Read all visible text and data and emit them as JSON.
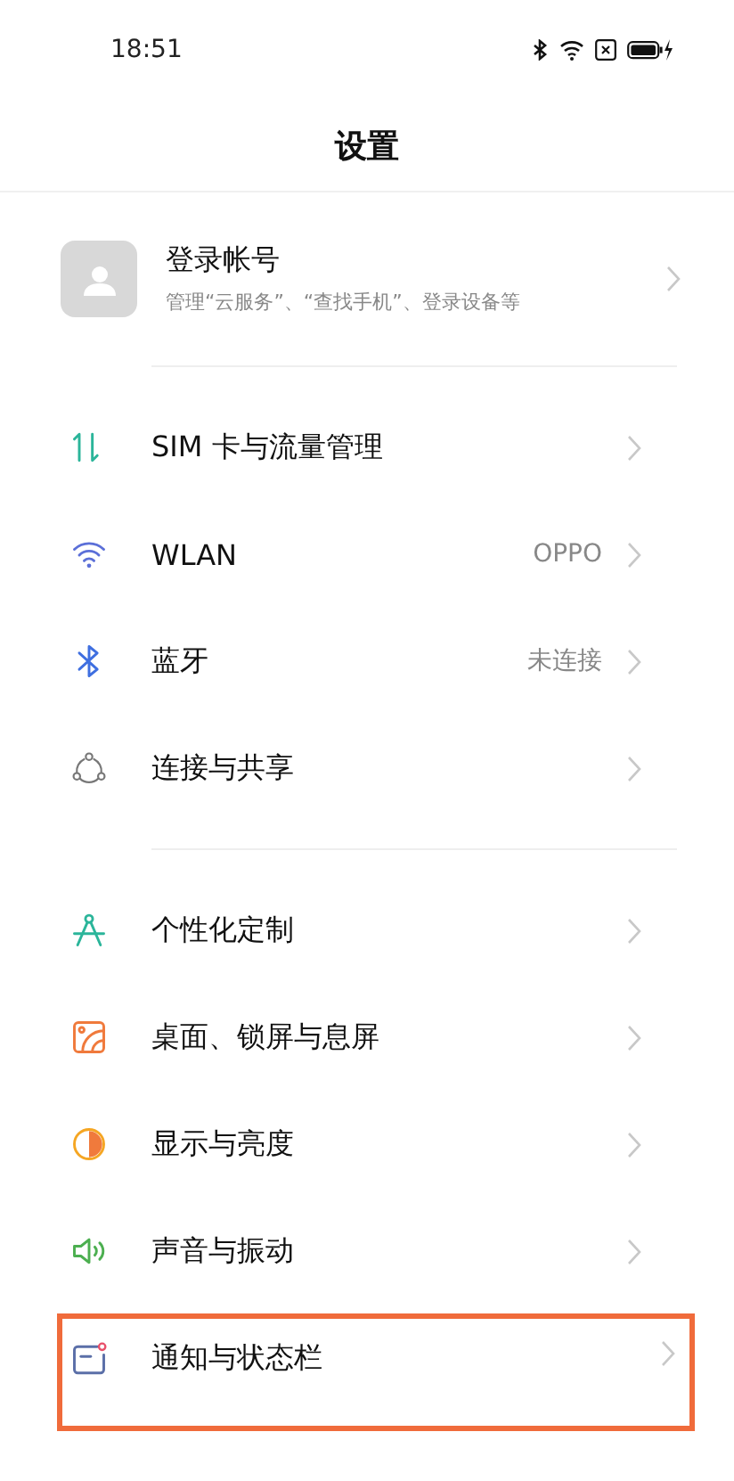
{
  "status_bar": {
    "time": "18:51"
  },
  "title": "设置",
  "account": {
    "name": "登录帐号",
    "subtitle": "管理“云服务”、“查找手机”、登录设备等"
  },
  "groups": [
    [
      {
        "kind": "sim",
        "label": "SIM 卡与流量管理",
        "highlighted": false
      },
      {
        "kind": "wlan",
        "label": "WLAN",
        "value": "OPPO",
        "highlighted": false
      },
      {
        "kind": "bluetooth",
        "label": "蓝牙",
        "value": "未连接",
        "highlighted": false
      },
      {
        "kind": "connect",
        "label": "连接与共享",
        "highlighted": false
      }
    ],
    [
      {
        "kind": "personalize",
        "label": "个性化定制",
        "highlighted": false
      },
      {
        "kind": "wallpaper",
        "label": "桌面、锁屏与息屏",
        "highlighted": false
      },
      {
        "kind": "display",
        "label": "显示与亮度",
        "highlighted": false
      },
      {
        "kind": "sound",
        "label": "声音与振动",
        "highlighted": false
      },
      {
        "kind": "notification",
        "label": "通知与状态栏",
        "highlighted": true
      }
    ]
  ]
}
